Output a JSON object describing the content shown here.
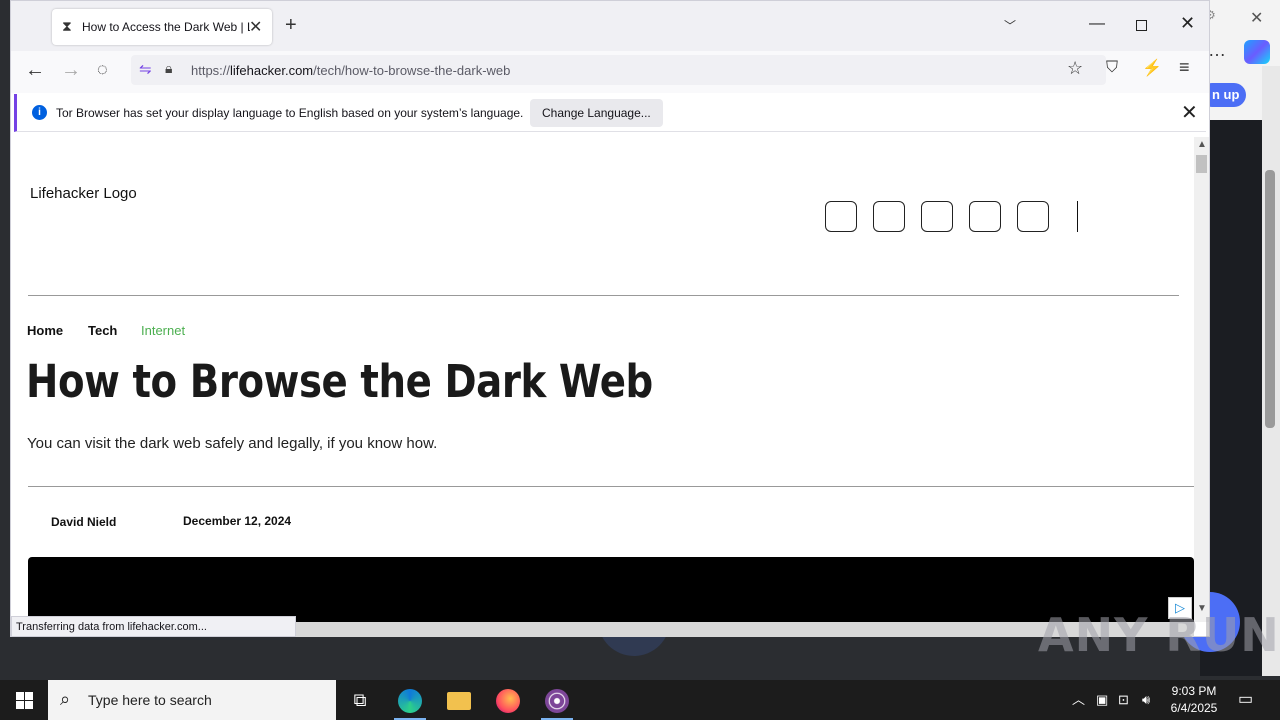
{
  "browser": {
    "tab_title": "How to Access the Dark Web | L",
    "url_prefix": "https://",
    "url_domain": "lifehacker.com",
    "url_path": "/tech/how-to-browse-the-dark-web",
    "status_text": "Transferring data from lifehacker.com..."
  },
  "notification": {
    "text": "Tor Browser has set your display language to English based on your system’s language.",
    "button_label": "Change Language..."
  },
  "page": {
    "logo_text": "Lifehacker Logo",
    "breadcrumbs": [
      "Home",
      "Tech",
      "Internet"
    ],
    "headline": "How to Browse the Dark Web",
    "dek": "You can visit the dark web safely and legally, if you know how.",
    "author": "David Nield",
    "date": "December 12, 2024"
  },
  "background_window": {
    "signup_label": "n up"
  },
  "watermark": "ANY RUN",
  "taskbar": {
    "search_placeholder": "Type here to search",
    "time": "9:03 PM",
    "date": "6/4/2025"
  },
  "colors": {
    "tor_accent": "#7542e5",
    "breadcrumb_active": "#4caf50",
    "info_blue": "#0060df"
  }
}
